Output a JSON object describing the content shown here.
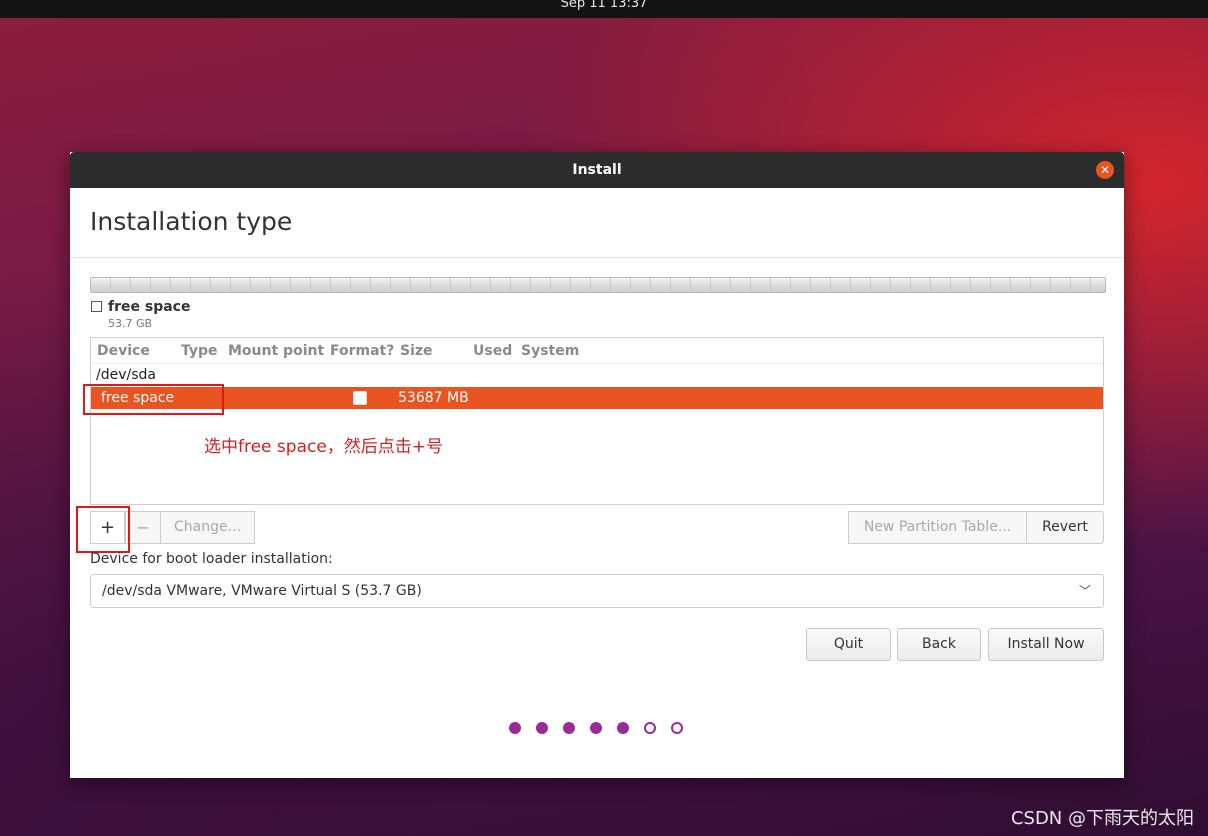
{
  "topbar": {
    "clock": "Sep 11  13:37"
  },
  "window": {
    "title": "Install",
    "close_icon": "close-icon",
    "page_title": "Installation type"
  },
  "partition_legend": {
    "label": "free space",
    "size": "53.7 GB"
  },
  "partition_table": {
    "columns": [
      "Device",
      "Type",
      "Mount point",
      "Format?",
      "Size",
      "Used",
      "System"
    ],
    "device_row": "/dev/sda",
    "selected_row": {
      "device": "free space",
      "size": "53687 MB",
      "format_checked": false
    }
  },
  "annotation": {
    "text": "选中free space，然后点击+号"
  },
  "toolbar": {
    "add_label": "+",
    "remove_label": "−",
    "change_label": "Change...",
    "new_table_label": "New Partition Table...",
    "revert_label": "Revert"
  },
  "boot_loader": {
    "label": "Device for boot loader installation:",
    "selected": "/dev/sda VMware, VMware Virtual S (53.7 GB)"
  },
  "actions": {
    "quit": "Quit",
    "back": "Back",
    "install_now": "Install Now"
  },
  "progress": {
    "total_steps": 7,
    "current_step": 5
  },
  "colors": {
    "accent": "#e95420",
    "progress": "#9b2b96",
    "annotation": "#e01818"
  },
  "watermark": "CSDN @下雨天的太阳"
}
